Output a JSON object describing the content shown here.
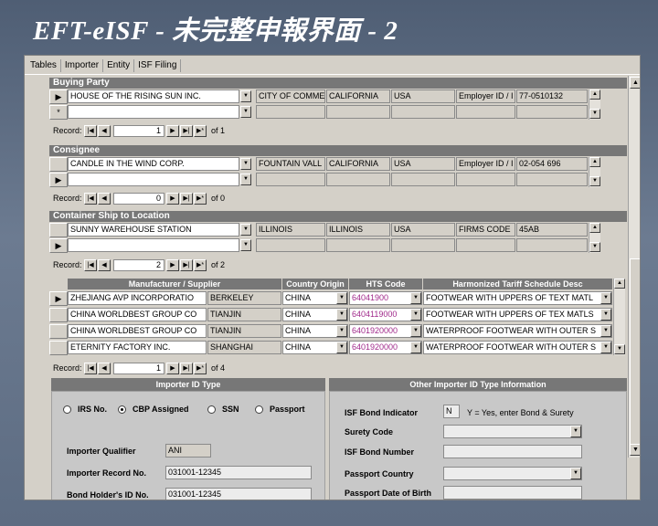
{
  "slide_title": "EFT-eISF - 未完整申報界面 - 2",
  "menu": [
    "Tables",
    "Importer",
    "Entity",
    "ISF Filing"
  ],
  "buying_party": {
    "header": "Buying Party",
    "rows": [
      {
        "selector": "▶",
        "name": "HOUSE OF THE RISING SUN INC.",
        "city": "CITY OF COMME",
        "state": "CALIFORNIA",
        "country": "USA",
        "id_type": "Employer ID / I",
        "id_number": "77-0510132"
      },
      {
        "selector": "*",
        "name": "",
        "city": "",
        "state": "",
        "country": "",
        "id_type": "",
        "id_number": ""
      }
    ],
    "nav": {
      "label": "Record:",
      "current": "1",
      "of": "of 1"
    }
  },
  "consignee": {
    "header": "Consignee",
    "rows": [
      {
        "selector": "",
        "name": "CANDLE IN THE WIND CORP.",
        "city": "FOUNTAIN VALL",
        "state": "CALIFORNIA",
        "country": "USA",
        "id_type": "Employer ID / I",
        "id_number": "02-054 696"
      },
      {
        "selector": "▶",
        "name": "",
        "city": "",
        "state": "",
        "country": "",
        "id_type": "",
        "id_number": ""
      }
    ],
    "nav": {
      "label": "Record:",
      "current": "0",
      "of": "of 0"
    }
  },
  "ship_to": {
    "header": "Container Ship to Location",
    "rows": [
      {
        "selector": "",
        "name": "SUNNY WAREHOUSE STATION",
        "city": "ILLINOIS",
        "state": "ILLINOIS",
        "country": "USA",
        "id_type": "FIRMS CODE",
        "id_number": "45AB"
      },
      {
        "selector": "▶",
        "name": "",
        "city": "",
        "state": "",
        "country": "",
        "id_type": "",
        "id_number": ""
      }
    ],
    "nav": {
      "label": "Record:",
      "current": "2",
      "of": "of 2"
    }
  },
  "manufacturer": {
    "columns": [
      "Manufacturer / Supplier",
      "Country Origin",
      "HTS Code",
      "Harmonized Tariff Schedule Desc"
    ],
    "rows": [
      {
        "selector": "▶",
        "name": "ZHEJIANG AVP INCORPORATIO",
        "city": "BERKELEY",
        "country": "CHINA",
        "hts": "64041900",
        "desc": "FOOTWEAR WITH UPPERS OF TEXT MATL"
      },
      {
        "selector": "",
        "name": "CHINA WORLDBEST GROUP CO",
        "city": "TIANJIN",
        "country": "CHINA",
        "hts": "6404119000",
        "desc": "FOOTWEAR WITH UPPERS OF TEX MATLS"
      },
      {
        "selector": "",
        "name": "CHINA WORLDBEST GROUP CO",
        "city": "TIANJIN",
        "country": "CHINA",
        "hts": "6401920000",
        "desc": "WATERPROOF FOOTWEAR WITH OUTER S"
      },
      {
        "selector": "",
        "name": "ETERNITY FACTORY INC.",
        "city": "SHANGHAI",
        "country": "CHINA",
        "hts": "6401920000",
        "desc": "WATERPROOF FOOTWEAR WITH OUTER S"
      }
    ],
    "nav": {
      "label": "Record:",
      "current": "1",
      "of": "of 4"
    }
  },
  "importer_id": {
    "header": "Importer ID Type",
    "options": [
      "IRS No.",
      "CBP Assigned",
      "SSN",
      "Passport"
    ],
    "selected": "CBP Assigned",
    "qualifier_label": "Importer Qualifier",
    "qualifier_value": "ANI",
    "record_label": "Importer Record No.",
    "record_value": "031001-12345",
    "bond_label": "Bond Holder's ID No.",
    "bond_value": "031001-12345"
  },
  "other_importer": {
    "header": "Other Importer ID Type Information",
    "bond_indicator_label": "ISF Bond Indicator",
    "bond_indicator_value": "N",
    "bond_indicator_hint": "Y = Yes, enter Bond & Surety",
    "surety_label": "Surety Code",
    "bond_number_label": "ISF Bond Number",
    "passport_country_label": "Passport Country",
    "passport_dob_label": "Passport Date of Birth"
  },
  "icons": {
    "dropdown": "chevron-down-icon",
    "scroll_up": "arrow-up-icon",
    "scroll_down": "arrow-down-icon"
  },
  "colors": {
    "background": "#5d6c82",
    "window": "#d4d0c8",
    "header": "#777777",
    "hts_text": "#a0288a"
  }
}
